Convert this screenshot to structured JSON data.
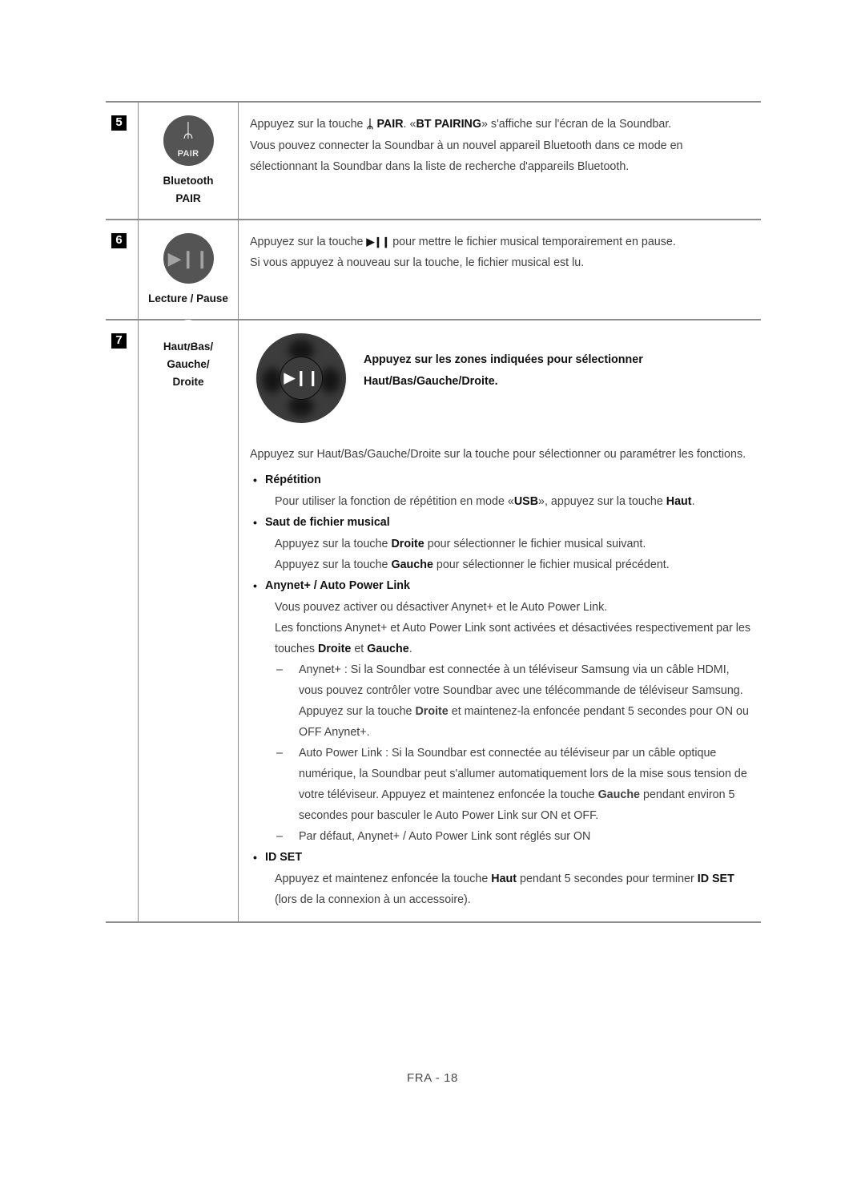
{
  "document": {
    "footer": "FRA - 18",
    "accent_dark": "#545454",
    "rule_color": "#8c8c8c",
    "text_color": "#3f3f3f",
    "bold_color": "#111111"
  },
  "table": {
    "rows": [
      {
        "number": "5",
        "icon": {
          "type": "bluetooth-pair-circle",
          "glyph": "ᛦ",
          "sublabel": "PAIR"
        },
        "caption_lines": [
          "Bluetooth",
          "PAIR"
        ],
        "paragraphs": [
          {
            "runs": [
              {
                "t": "Appuyez sur la touche ",
                "b": false
              },
              {
                "t": "ᛦ",
                "b": true,
                "cls": "bt-inline"
              },
              {
                "t": " PAIR",
                "b": true
              },
              {
                "t": ". «",
                "b": false
              },
              {
                "t": "BT PAIRING",
                "b": true
              },
              {
                "t": "» s'affiche sur l'écran de la Soundbar.",
                "b": false
              }
            ]
          },
          {
            "runs": [
              {
                "t": "Vous pouvez connecter la Soundbar à un nouvel appareil Bluetooth dans ce mode en sélectionnant la Soundbar dans la liste de recherche d'appareils Bluetooth.",
                "b": false
              }
            ]
          }
        ]
      },
      {
        "number": "6",
        "icon": {
          "type": "play-pause-circle",
          "glyph": "▶❙❙"
        },
        "caption_lines": [
          "Lecture / Pause"
        ],
        "paragraphs": [
          {
            "runs": [
              {
                "t": "Appuyez sur la touche ",
                "b": false
              },
              {
                "t": "▶❙❙",
                "b": true,
                "cls": "pp-inline"
              },
              {
                "t": " pour mettre le fichier musical temporairement en pause.",
                "b": false
              }
            ]
          },
          {
            "runs": [
              {
                "t": "Si vous appuyez à nouveau sur la touche, le fichier musical est lu.",
                "b": false
              }
            ]
          }
        ]
      },
      {
        "number": "7",
        "icon": {
          "type": "ring"
        },
        "caption_lines": [
          "Haut/Bas/",
          "Gauche/",
          "Droite"
        ],
        "dpad": {
          "type": "dpad-circle",
          "center_glyph": "▶❙❙"
        },
        "lead_bold": "Appuyez sur les zones indiquées pour sélectionner Haut/Bas/Gauche/Droite.",
        "intro": "Appuyez sur Haut/Bas/Gauche/Droite sur la touche pour sélectionner ou paramétrer les fonctions.",
        "bullets": [
          {
            "head": "Répétition",
            "lines": [
              {
                "runs": [
                  {
                    "t": "Pour utiliser la fonction de répétition en mode «",
                    "b": false
                  },
                  {
                    "t": "USB",
                    "b": true
                  },
                  {
                    "t": "», appuyez sur la touche ",
                    "b": false
                  },
                  {
                    "t": "Haut",
                    "b": true
                  },
                  {
                    "t": ".",
                    "b": false
                  }
                ]
              }
            ]
          },
          {
            "head": "Saut de fichier musical",
            "lines": [
              {
                "runs": [
                  {
                    "t": "Appuyez sur la touche ",
                    "b": false
                  },
                  {
                    "t": "Droite",
                    "b": true
                  },
                  {
                    "t": " pour sélectionner le fichier musical suivant.",
                    "b": false
                  }
                ]
              },
              {
                "runs": [
                  {
                    "t": "Appuyez sur la touche ",
                    "b": false
                  },
                  {
                    "t": "Gauche",
                    "b": true
                  },
                  {
                    "t": " pour sélectionner le fichier musical précédent.",
                    "b": false
                  }
                ]
              }
            ]
          },
          {
            "head": "Anynet+ / Auto Power Link",
            "lines": [
              {
                "runs": [
                  {
                    "t": "Vous pouvez activer ou désactiver Anynet+ et le Auto Power Link.",
                    "b": false
                  }
                ]
              },
              {
                "runs": [
                  {
                    "t": "Les fonctions Anynet+ et Auto Power Link sont activées et désactivées respectivement par les touches ",
                    "b": false
                  },
                  {
                    "t": "Droite",
                    "b": true
                  },
                  {
                    "t": " et ",
                    "b": false
                  },
                  {
                    "t": "Gauche",
                    "b": true
                  },
                  {
                    "t": ".",
                    "b": false
                  }
                ]
              }
            ],
            "dashes": [
              {
                "runs": [
                  {
                    "t": "Anynet+ : Si la Soundbar est connectée à un téléviseur Samsung via un câble HDMI, vous pouvez contrôler votre Soundbar avec une télécommande de téléviseur Samsung. Appuyez sur la touche ",
                    "b": false
                  },
                  {
                    "t": "Droite",
                    "b": true
                  },
                  {
                    "t": " et maintenez-la enfoncée pendant 5 secondes pour ON ou OFF Anynet+.",
                    "b": false
                  }
                ]
              },
              {
                "runs": [
                  {
                    "t": "Auto Power Link : Si la Soundbar est connectée au téléviseur par un câble optique numérique, la Soundbar peut s'allumer automatiquement lors de la mise sous tension de votre téléviseur. Appuyez et maintenez enfoncée la touche ",
                    "b": false
                  },
                  {
                    "t": "Gauche",
                    "b": true
                  },
                  {
                    "t": " pendant environ 5 secondes pour basculer le Auto Power Link sur ON et OFF.",
                    "b": false
                  }
                ]
              },
              {
                "runs": [
                  {
                    "t": "Par défaut, Anynet+ / Auto Power Link sont réglés sur ON",
                    "b": false
                  }
                ]
              }
            ]
          },
          {
            "head": "ID SET",
            "lines": [
              {
                "runs": [
                  {
                    "t": "Appuyez et maintenez enfoncée la touche ",
                    "b": false
                  },
                  {
                    "t": "Haut",
                    "b": true
                  },
                  {
                    "t": " pendant 5 secondes pour terminer ",
                    "b": false
                  },
                  {
                    "t": "ID SET",
                    "b": true
                  },
                  {
                    "t": " (lors de la connexion à un accessoire).",
                    "b": false
                  }
                ]
              }
            ]
          }
        ]
      }
    ]
  }
}
